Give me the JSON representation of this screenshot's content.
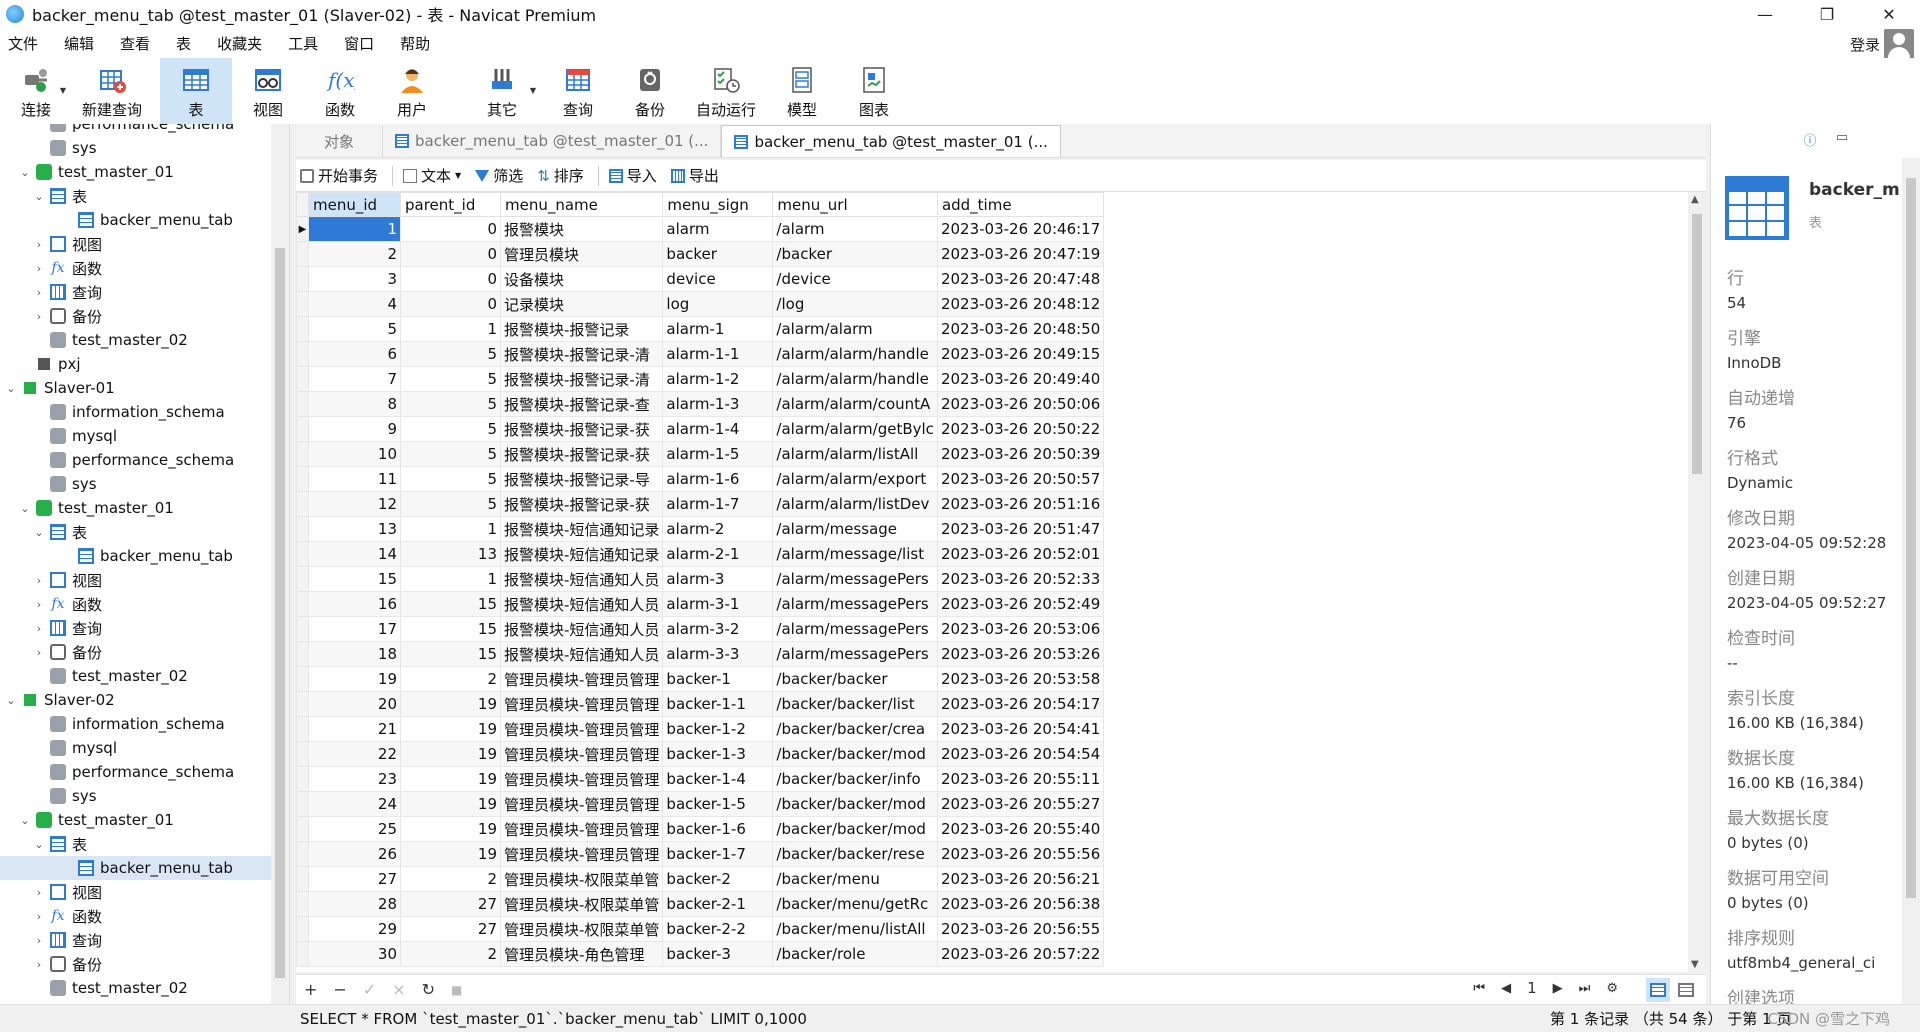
{
  "window": {
    "title": "backer_menu_tab @test_master_01 (Slaver-02) - 表 - Navicat Premium",
    "minimize": "—",
    "maximize": "❐",
    "close": "✕"
  },
  "menubar": {
    "items": [
      "文件",
      "编辑",
      "查看",
      "表",
      "收藏夹",
      "工具",
      "窗口",
      "帮助"
    ],
    "login": "登录"
  },
  "toolbar": {
    "buttons": [
      {
        "label": "连接",
        "icon": "connection-icon"
      },
      {
        "label": "新建查询",
        "icon": "new-query-icon"
      },
      {
        "label": "表",
        "icon": "table-icon"
      },
      {
        "label": "视图",
        "icon": "view-icon"
      },
      {
        "label": "函数",
        "icon": "function-icon"
      },
      {
        "label": "用户",
        "icon": "user-icon"
      },
      {
        "label": "其它",
        "icon": "tools-icon"
      },
      {
        "label": "查询",
        "icon": "query-icon"
      },
      {
        "label": "备份",
        "icon": "backup-icon"
      },
      {
        "label": "自动运行",
        "icon": "automation-icon"
      },
      {
        "label": "模型",
        "icon": "model-icon"
      },
      {
        "label": "图表",
        "icon": "chart-icon"
      }
    ]
  },
  "navigator": {
    "rows": [
      {
        "label": "performance_schema",
        "indent": 2,
        "arrow": "",
        "icon": "db"
      },
      {
        "label": "sys",
        "indent": 2,
        "arrow": "",
        "icon": "db"
      },
      {
        "label": "test_master_01",
        "indent": 1,
        "arrow": "⌄",
        "icon": "db-green"
      },
      {
        "label": "表",
        "indent": 2,
        "arrow": "⌄",
        "icon": "table"
      },
      {
        "label": "backer_menu_tab",
        "indent": 4,
        "arrow": "",
        "icon": "table"
      },
      {
        "label": "视图",
        "indent": 2,
        "arrow": "›",
        "icon": "view"
      },
      {
        "label": "函数",
        "indent": 2,
        "arrow": "›",
        "icon": "fx"
      },
      {
        "label": "查询",
        "indent": 2,
        "arrow": "›",
        "icon": "query"
      },
      {
        "label": "备份",
        "indent": 2,
        "arrow": "›",
        "icon": "backup"
      },
      {
        "label": "test_master_02",
        "indent": 2,
        "arrow": "",
        "icon": "db"
      },
      {
        "label": "pxj",
        "indent": 1,
        "arrow": "",
        "icon": "conn-gray"
      },
      {
        "label": "Slaver-01",
        "indent": 0,
        "arrow": "⌄",
        "icon": "conn"
      },
      {
        "label": "information_schema",
        "indent": 2,
        "arrow": "",
        "icon": "db"
      },
      {
        "label": "mysql",
        "indent": 2,
        "arrow": "",
        "icon": "db"
      },
      {
        "label": "performance_schema",
        "indent": 2,
        "arrow": "",
        "icon": "db"
      },
      {
        "label": "sys",
        "indent": 2,
        "arrow": "",
        "icon": "db"
      },
      {
        "label": "test_master_01",
        "indent": 1,
        "arrow": "⌄",
        "icon": "db-green"
      },
      {
        "label": "表",
        "indent": 2,
        "arrow": "⌄",
        "icon": "table"
      },
      {
        "label": "backer_menu_tab",
        "indent": 4,
        "arrow": "",
        "icon": "table"
      },
      {
        "label": "视图",
        "indent": 2,
        "arrow": "›",
        "icon": "view"
      },
      {
        "label": "函数",
        "indent": 2,
        "arrow": "›",
        "icon": "fx"
      },
      {
        "label": "查询",
        "indent": 2,
        "arrow": "›",
        "icon": "query"
      },
      {
        "label": "备份",
        "indent": 2,
        "arrow": "›",
        "icon": "backup"
      },
      {
        "label": "test_master_02",
        "indent": 2,
        "arrow": "",
        "icon": "db"
      },
      {
        "label": "Slaver-02",
        "indent": 0,
        "arrow": "⌄",
        "icon": "conn"
      },
      {
        "label": "information_schema",
        "indent": 2,
        "arrow": "",
        "icon": "db"
      },
      {
        "label": "mysql",
        "indent": 2,
        "arrow": "",
        "icon": "db"
      },
      {
        "label": "performance_schema",
        "indent": 2,
        "arrow": "",
        "icon": "db"
      },
      {
        "label": "sys",
        "indent": 2,
        "arrow": "",
        "icon": "db"
      },
      {
        "label": "test_master_01",
        "indent": 1,
        "arrow": "⌄",
        "icon": "db-green"
      },
      {
        "label": "表",
        "indent": 2,
        "arrow": "⌄",
        "icon": "table"
      },
      {
        "label": "backer_menu_tab",
        "indent": 4,
        "arrow": "",
        "icon": "table",
        "selected": true
      },
      {
        "label": "视图",
        "indent": 2,
        "arrow": "›",
        "icon": "view"
      },
      {
        "label": "函数",
        "indent": 2,
        "arrow": "›",
        "icon": "fx"
      },
      {
        "label": "查询",
        "indent": 2,
        "arrow": "›",
        "icon": "query"
      },
      {
        "label": "备份",
        "indent": 2,
        "arrow": "›",
        "icon": "backup"
      },
      {
        "label": "test_master_02",
        "indent": 2,
        "arrow": "",
        "icon": "db"
      }
    ]
  },
  "tabs": {
    "objects": "对象",
    "tab1": "backer_menu_tab @test_master_01 (...",
    "tab2": "backer_menu_tab @test_master_01 (..."
  },
  "datatoolbar": {
    "begin_tx": "开始事务",
    "text": "文本",
    "filter": "筛选",
    "sort": "排序",
    "import": "导入",
    "export": "导出"
  },
  "grid": {
    "columns": [
      "menu_id",
      "parent_id",
      "menu_name",
      "menu_sign",
      "menu_url",
      "add_time"
    ],
    "rows": [
      [
        "1",
        "0",
        "报警模块",
        "alarm",
        "/alarm",
        "2023-03-26 20:46:17"
      ],
      [
        "2",
        "0",
        "管理员模块",
        "backer",
        "/backer",
        "2023-03-26 20:47:19"
      ],
      [
        "3",
        "0",
        "设备模块",
        "device",
        "/device",
        "2023-03-26 20:47:48"
      ],
      [
        "4",
        "0",
        "记录模块",
        "log",
        "/log",
        "2023-03-26 20:48:12"
      ],
      [
        "5",
        "1",
        "报警模块-报警记录",
        "alarm-1",
        "/alarm/alarm",
        "2023-03-26 20:48:50"
      ],
      [
        "6",
        "5",
        "报警模块-报警记录-清",
        "alarm-1-1",
        "/alarm/alarm/handle",
        "2023-03-26 20:49:15"
      ],
      [
        "7",
        "5",
        "报警模块-报警记录-清",
        "alarm-1-2",
        "/alarm/alarm/handle",
        "2023-03-26 20:49:40"
      ],
      [
        "8",
        "5",
        "报警模块-报警记录-查",
        "alarm-1-3",
        "/alarm/alarm/countA",
        "2023-03-26 20:50:06"
      ],
      [
        "9",
        "5",
        "报警模块-报警记录-获",
        "alarm-1-4",
        "/alarm/alarm/getBylc",
        "2023-03-26 20:50:22"
      ],
      [
        "10",
        "5",
        "报警模块-报警记录-获",
        "alarm-1-5",
        "/alarm/alarm/listAll",
        "2023-03-26 20:50:39"
      ],
      [
        "11",
        "5",
        "报警模块-报警记录-导",
        "alarm-1-6",
        "/alarm/alarm/export",
        "2023-03-26 20:50:57"
      ],
      [
        "12",
        "5",
        "报警模块-报警记录-获",
        "alarm-1-7",
        "/alarm/alarm/listDev",
        "2023-03-26 20:51:16"
      ],
      [
        "13",
        "1",
        "报警模块-短信通知记录",
        "alarm-2",
        "/alarm/message",
        "2023-03-26 20:51:47"
      ],
      [
        "14",
        "13",
        "报警模块-短信通知记录",
        "alarm-2-1",
        "/alarm/message/list",
        "2023-03-26 20:52:01"
      ],
      [
        "15",
        "1",
        "报警模块-短信通知人员",
        "alarm-3",
        "/alarm/messagePers",
        "2023-03-26 20:52:33"
      ],
      [
        "16",
        "15",
        "报警模块-短信通知人员",
        "alarm-3-1",
        "/alarm/messagePers",
        "2023-03-26 20:52:49"
      ],
      [
        "17",
        "15",
        "报警模块-短信通知人员",
        "alarm-3-2",
        "/alarm/messagePers",
        "2023-03-26 20:53:06"
      ],
      [
        "18",
        "15",
        "报警模块-短信通知人员",
        "alarm-3-3",
        "/alarm/messagePers",
        "2023-03-26 20:53:26"
      ],
      [
        "19",
        "2",
        "管理员模块-管理员管理",
        "backer-1",
        "/backer/backer",
        "2023-03-26 20:53:58"
      ],
      [
        "20",
        "19",
        "管理员模块-管理员管理",
        "backer-1-1",
        "/backer/backer/list",
        "2023-03-26 20:54:17"
      ],
      [
        "21",
        "19",
        "管理员模块-管理员管理",
        "backer-1-2",
        "/backer/backer/crea",
        "2023-03-26 20:54:41"
      ],
      [
        "22",
        "19",
        "管理员模块-管理员管理",
        "backer-1-3",
        "/backer/backer/mod",
        "2023-03-26 20:54:54"
      ],
      [
        "23",
        "19",
        "管理员模块-管理员管理",
        "backer-1-4",
        "/backer/backer/info",
        "2023-03-26 20:55:11"
      ],
      [
        "24",
        "19",
        "管理员模块-管理员管理",
        "backer-1-5",
        "/backer/backer/mod",
        "2023-03-26 20:55:27"
      ],
      [
        "25",
        "19",
        "管理员模块-管理员管理",
        "backer-1-6",
        "/backer/backer/mod",
        "2023-03-26 20:55:40"
      ],
      [
        "26",
        "19",
        "管理员模块-管理员管理",
        "backer-1-7",
        "/backer/backer/rese",
        "2023-03-26 20:55:56"
      ],
      [
        "27",
        "2",
        "管理员模块-权限菜单管",
        "backer-2",
        "/backer/menu",
        "2023-03-26 20:56:21"
      ],
      [
        "28",
        "27",
        "管理员模块-权限菜单管",
        "backer-2-1",
        "/backer/menu/getRc",
        "2023-03-26 20:56:38"
      ],
      [
        "29",
        "27",
        "管理员模块-权限菜单管",
        "backer-2-2",
        "/backer/menu/listAll",
        "2023-03-26 20:56:55"
      ],
      [
        "30",
        "2",
        "管理员模块-角色管理",
        "backer-3",
        "/backer/role",
        "2023-03-26 20:57:22"
      ]
    ]
  },
  "gridbottom": {
    "add": "+",
    "remove": "−",
    "apply": "✓",
    "discard": "×",
    "refresh": "↻",
    "stop": "■",
    "first": "⏮",
    "prev": "◀",
    "page": "1",
    "next": "▶",
    "last": "⏭",
    "settings": "⚙"
  },
  "infopanel": {
    "name": "backer_m",
    "type": "表",
    "props": [
      {
        "k": "行",
        "v": "54"
      },
      {
        "k": "引擎",
        "v": "InnoDB"
      },
      {
        "k": "自动递增",
        "v": "76"
      },
      {
        "k": "行格式",
        "v": "Dynamic"
      },
      {
        "k": "修改日期",
        "v": "2023-04-05 09:52:28"
      },
      {
        "k": "创建日期",
        "v": "2023-04-05 09:52:27"
      },
      {
        "k": "检查时间",
        "v": "--"
      },
      {
        "k": "索引长度",
        "v": "16.00 KB (16,384)"
      },
      {
        "k": "数据长度",
        "v": "16.00 KB (16,384)"
      },
      {
        "k": "最大数据长度",
        "v": "0 bytes (0)"
      },
      {
        "k": "数据可用空间",
        "v": "0 bytes (0)"
      },
      {
        "k": "排序规则",
        "v": "utf8mb4_general_ci"
      },
      {
        "k": "创建选项",
        "v": ""
      }
    ]
  },
  "statusbar": {
    "sql": "SELECT * FROM `test_master_01`.`backer_menu_tab` LIMIT 0,1000",
    "records": "第 1 条记录 （共 54 条） 于第 1 页",
    "watermark": "CSDN @雪之下鸡"
  }
}
